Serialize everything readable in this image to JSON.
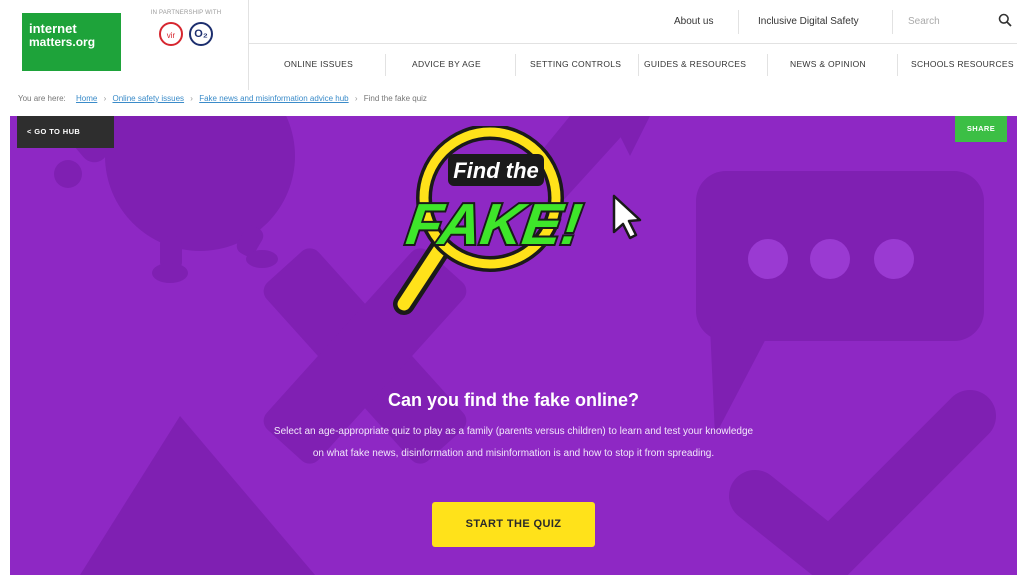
{
  "brand": {
    "logo_line1": "internet",
    "logo_line2": "matters.org",
    "partner_text": "IN PARTNERSHIP WITH",
    "partner1": "vir",
    "partner2": "O₂"
  },
  "util": {
    "about": "About us",
    "inclusive": "Inclusive Digital Safety",
    "search_placeholder": "Search"
  },
  "nav": {
    "items": [
      "ONLINE ISSUES",
      "ADVICE BY AGE",
      "SETTING CONTROLS",
      "GUIDES & RESOURCES",
      "NEWS & OPINION",
      "SCHOOLS RESOURCES"
    ]
  },
  "breadcrumb": {
    "prefix": "You are here:",
    "items": [
      "Home",
      "Online safety issues",
      "Fake news and misinformation advice hub",
      "Find the fake quiz"
    ]
  },
  "hero": {
    "goto_hub": "<  GO TO HUB",
    "share": "SHARE",
    "logo_top": "Find the",
    "logo_bottom": "FAKE!",
    "title": "Can you find the fake online?",
    "desc_line1": "Select an age-appropriate quiz to play as a family (parents versus children) to learn and test your knowledge",
    "desc_line2": "on what fake news, disinformation and misinformation is and how to stop it from spreading.",
    "cta": "START THE QUIZ"
  },
  "colors": {
    "brand_green": "#1ea33a",
    "hero_purple": "#8e28c4",
    "cta_yellow": "#ffe21a",
    "share_green": "#3cbf45",
    "logo_green": "#3ee62a"
  }
}
